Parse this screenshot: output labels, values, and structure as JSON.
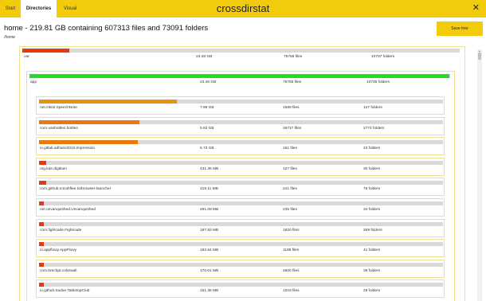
{
  "header": {
    "title": "crossdirstat",
    "tabs": [
      {
        "label": "Start",
        "active": false
      },
      {
        "label": "Directories",
        "active": true
      },
      {
        "label": "Visual",
        "active": false
      }
    ],
    "close_icon": "close-icon",
    "close_glyph": "✕"
  },
  "summary": "home - 219.81 GB containing 607313 files and 73091 folders",
  "breadcrumb": "/home",
  "save_tree_label": "Save tree",
  "colors": {
    "accent": "#f2cc0c",
    "bar_red": "#e53a10",
    "bar_orange": "#e8920e",
    "bar_green": "#22dd22",
    "box_border": "#eee18f"
  },
  "entries": [
    {
      "name": ".var",
      "size": "23.48 GB",
      "files": "75758 files",
      "folders": "10737 folders",
      "fill": 0.107,
      "color": "#e53a10"
    },
    {
      "name": "app",
      "size": "23.46 GB",
      "files": "75755 files",
      "folders": "10736 folders",
      "fill": 0.999,
      "color": "#22dd22"
    }
  ],
  "children": [
    {
      "name": "net.mkiol.SpeechNote",
      "size": "7.99 GB",
      "files": "1689 files",
      "folders": "127 folders",
      "fill": 0.341,
      "color": "#e8920e"
    },
    {
      "name": "com.usebottles.bottles",
      "size": "5.82 GB",
      "files": "26717 files",
      "folders": "2774 folders",
      "fill": 0.248,
      "color": "#e8790e"
    },
    {
      "name": "io.gitlab.adhami3310.Impression",
      "size": "5.73 GB",
      "files": "151 files",
      "folders": "23 folders",
      "fill": 0.244,
      "color": "#e8790e"
    },
    {
      "name": "org.kde.digikam",
      "size": "431.36 MB",
      "files": "127 files",
      "folders": "30 folders",
      "fill": 0.018,
      "color": "#e53a10"
    },
    {
      "name": "com.github.micahflee.torbrowser-launcher",
      "size": "419.11 MB",
      "files": "241 files",
      "folders": "76 folders",
      "fill": 0.017,
      "color": "#e53a10"
    },
    {
      "name": "net.unvanquished.Unvanquished",
      "size": "291.09 MB",
      "files": "235 files",
      "folders": "34 folders",
      "fill": 0.012,
      "color": "#e53a10"
    },
    {
      "name": "com.fightcade.Fightcade",
      "size": "197.83 MB",
      "files": "1820 files",
      "folders": "269 folders",
      "fill": 0.008,
      "color": "#e53a10"
    },
    {
      "name": "io.appflowy.AppFlowy",
      "size": "182.64 MB",
      "files": "1198 files",
      "folders": "41 folders",
      "fill": 0.008,
      "color": "#e53a10"
    },
    {
      "name": "com.brechpt.colorwall",
      "size": "170.01 MB",
      "files": "2600 files",
      "folders": "38 folders",
      "fill": 0.007,
      "color": "#e53a10"
    },
    {
      "name": "io.github.tradue.TabletopClub",
      "size": "161.36 MB",
      "files": "1203 files",
      "folders": "29 folders",
      "fill": 0.007,
      "color": "#e53a10"
    }
  ]
}
